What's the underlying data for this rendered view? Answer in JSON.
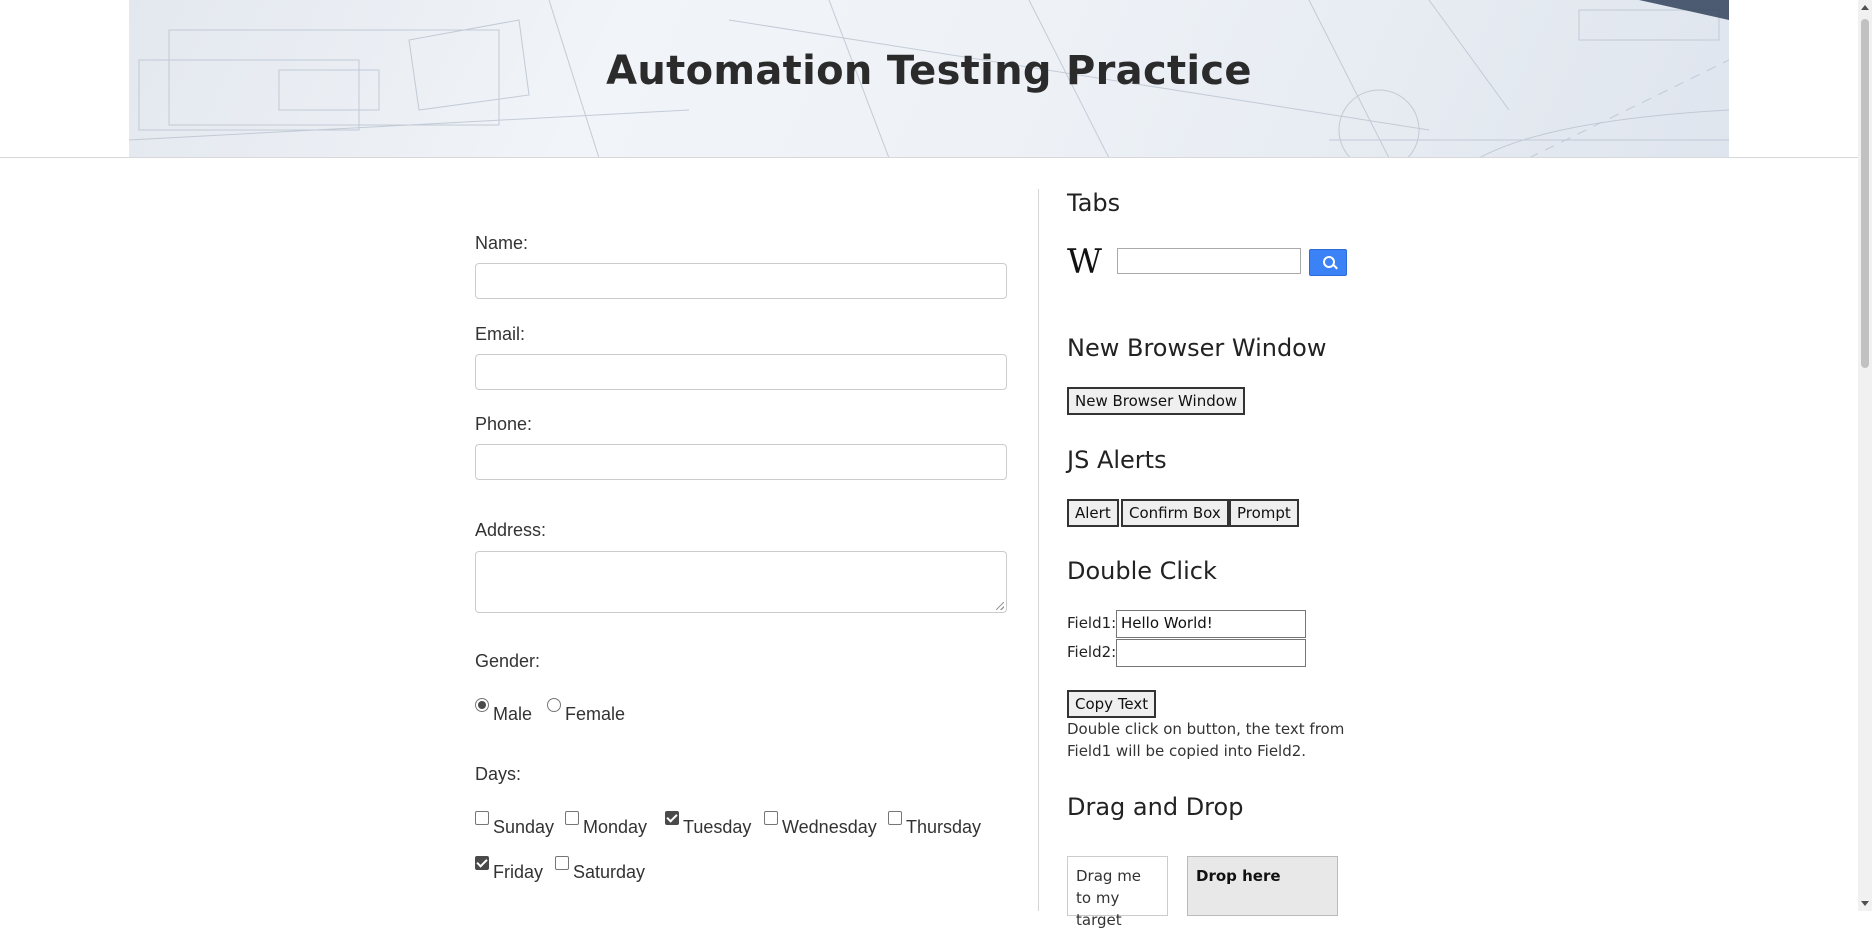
{
  "header": {
    "title": "Automation Testing Practice"
  },
  "form": {
    "name_label": "Name:",
    "email_label": "Email:",
    "phone_label": "Phone:",
    "address_label": "Address:",
    "gender_label": "Gender:",
    "gender_options": [
      {
        "label": "Male",
        "selected": true
      },
      {
        "label": "Female",
        "selected": false
      }
    ],
    "days_label": "Days:",
    "days": [
      {
        "label": "Sunday",
        "checked": false
      },
      {
        "label": "Monday",
        "checked": false
      },
      {
        "label": "Tuesday",
        "checked": true
      },
      {
        "label": "Wednesday",
        "checked": false
      },
      {
        "label": "Thursday",
        "checked": false
      },
      {
        "label": "Friday",
        "checked": true
      },
      {
        "label": "Saturday",
        "checked": false
      }
    ]
  },
  "right": {
    "tabs_heading": "Tabs",
    "wiki_logo": "W",
    "new_window_heading": "New Browser Window",
    "new_window_button": "New Browser Window",
    "alerts_heading": "JS Alerts",
    "alert_button": "Alert",
    "confirm_button": "Confirm Box",
    "prompt_button": "Prompt",
    "double_click_heading": "Double Click",
    "field1_label": "Field1:",
    "field1_value": "Hello World!",
    "field2_label": "Field2:",
    "field2_value": "",
    "copy_button": "Copy Text",
    "copy_note": "Double click on button, the text from Field1 will be copied into Field2.",
    "drag_heading": "Drag and Drop",
    "drag_text": "Drag me to my target",
    "drop_text": "Drop here"
  },
  "colors": {
    "search_button": "#3b82f6",
    "drop_zone": "#e8e8e8"
  }
}
